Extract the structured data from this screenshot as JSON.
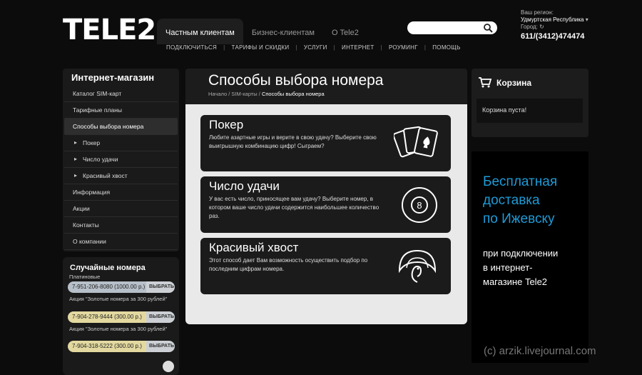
{
  "header": {
    "logo_text": "TELE2",
    "tabs": [
      {
        "label": "Частным клиентам",
        "active": true
      },
      {
        "label": "Бизнес-клиентам",
        "active": false
      },
      {
        "label": "О Tele2",
        "active": false
      }
    ],
    "subnav": [
      "ПОДКЛЮЧИТЬСЯ",
      "ТАРИФЫ И СКИДКИ",
      "УСЛУГИ",
      "ИНТЕРНЕТ",
      "РОУМИНГ",
      "ПОМОЩЬ"
    ],
    "search_value": "",
    "region_label": "Ваш регион:",
    "region_value": "Удмуртская Республика",
    "city_label": "Город:",
    "phone": "611/(3412)474474"
  },
  "sidebar": {
    "shop_title": "Интернет-магазин",
    "items": [
      {
        "label": "Каталог SIM-карт",
        "type": "item"
      },
      {
        "label": "Тарифные планы",
        "type": "item"
      },
      {
        "label": "Способы выбора номера",
        "type": "active"
      },
      {
        "label": "Покер",
        "type": "sub"
      },
      {
        "label": "Число удачи",
        "type": "sub"
      },
      {
        "label": "Красивый хвост",
        "type": "sub"
      },
      {
        "label": "Информация",
        "type": "item"
      },
      {
        "label": "Акции",
        "type": "item"
      },
      {
        "label": "Контакты",
        "type": "item"
      },
      {
        "label": "О компании",
        "type": "item"
      }
    ],
    "random": {
      "title": "Случайные номера",
      "subtitle": "Платиновые",
      "rows": [
        {
          "number": "7-951-206-8080",
          "price": "(1000.00 р.)",
          "button": "ВЫБРАТЬ"
        },
        {
          "number": "7-904-278-9444",
          "price": "(300.00 р.)",
          "button": "ВЫБРАТЬ"
        },
        {
          "number": "7-904-318-5222",
          "price": "(300.00 р.)",
          "button": "ВЫБРАТЬ"
        }
      ],
      "promo": "Акция \"Золотые номера за 300 рублей\""
    }
  },
  "main": {
    "title": "Способы выбора номера",
    "breadcrumb": {
      "home": "Начало",
      "sep": " / ",
      "parent": "SIM-карты",
      "current": "Способы выбора номера"
    },
    "cards": [
      {
        "title": "Покер",
        "text": "Любите азартные игры и верите в свою удачу? Выберите свою выигрышную комбинацию цифр! Сыграем?",
        "icon": "cards-icon"
      },
      {
        "title": "Число удачи",
        "text": "У вас есть число, приносящее вам удачу? Выберите номер, в котором ваше число удачи содержится наибольшее количество раз.",
        "icon": "eight-ball-icon"
      },
      {
        "title": "Красивый хвост",
        "text": "Этот способ дает Вам возможность осуществить подбор по последним цифрам номера.",
        "icon": "peacock-icon"
      }
    ]
  },
  "cart": {
    "title": "Корзина",
    "empty_text": "Корзина пуста!"
  },
  "ad": {
    "headline_lines": [
      "Бесплатная",
      "доставка",
      "по Ижевску"
    ],
    "text_lines": [
      "при подключении",
      "в интернет-",
      "магазине Tele2"
    ]
  },
  "watermark": "(c)  arzik.livejournal.com",
  "colors": {
    "accent_blue": "#1e9bd7",
    "background": "#0c0c0c",
    "panel": "#1b1b1b",
    "content_bg": "#e9e9e9"
  }
}
